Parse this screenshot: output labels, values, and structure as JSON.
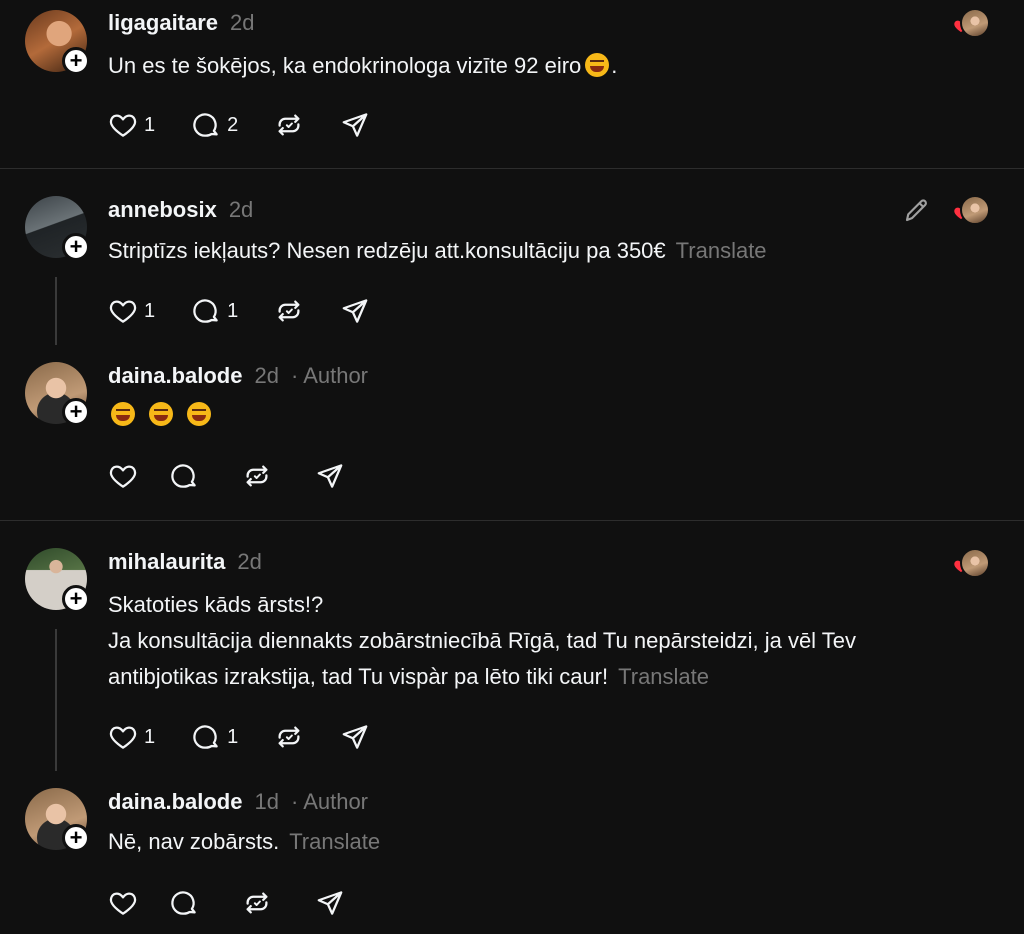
{
  "posts": [
    {
      "username": "ligagaitare",
      "time": "2d",
      "text": "Un es te šokējos, ka endokrinologa vizīte 92 eiro",
      "text_suffix": ".",
      "likes": "1",
      "replies": "2"
    },
    {
      "username": "annebosix",
      "time": "2d",
      "text": "Striptīzs iekļauts? Nesen redzēju att.konsultāciju pa 350€",
      "translate": "Translate",
      "likes": "1",
      "replies": "1"
    },
    {
      "username": "daina.balode",
      "time": "2d",
      "author_badge": "· Author"
    },
    {
      "username": "mihalaurita",
      "time": "2d",
      "line1": "Skatoties kāds ārsts!?",
      "line2": "Ja konsultācija diennakts zobārstniecībā Rīgā, tad Tu nepārsteidzi, ja vēl Tev",
      "line3": "antibjotikas izrakstija, tad Tu vispàr pa lēto tiki caur!",
      "translate": "Translate",
      "likes": "1",
      "replies": "1"
    },
    {
      "username": "daina.balode",
      "time": "1d",
      "author_badge": "· Author",
      "text": "Nē, nav zobārsts.",
      "translate": "Translate"
    }
  ],
  "icons": {
    "like": "heart-outline-icon",
    "reply": "comment-bubble-icon",
    "repost": "repost-icon",
    "share": "send-icon",
    "edit": "pencil-icon",
    "liked_by_author": "heart-filled-icon"
  },
  "colors": {
    "background": "#101010",
    "text": "#f3f5f7",
    "muted": "#777777",
    "heart": "#ff3040"
  }
}
